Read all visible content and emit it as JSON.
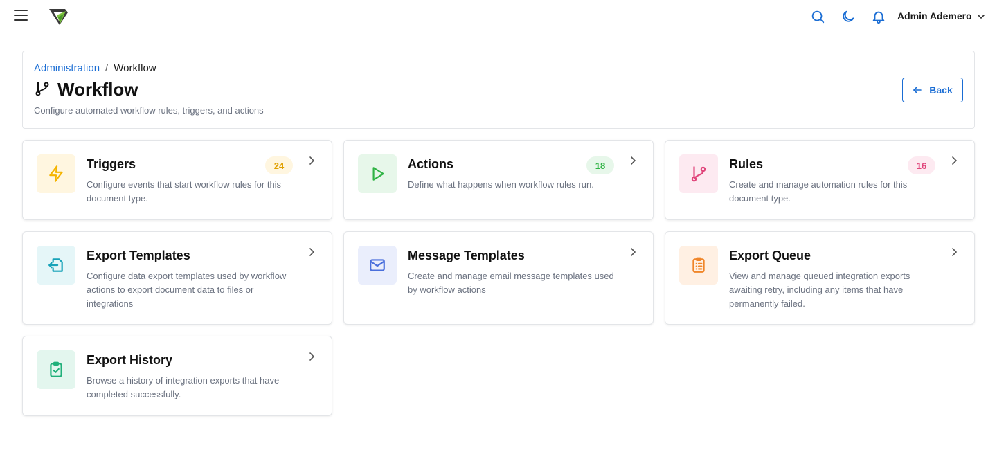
{
  "topbar": {
    "user_name": "Admin Ademero",
    "accent": "#1a6dd4"
  },
  "header": {
    "breadcrumb": {
      "parent": "Administration",
      "separator": "/",
      "current": "Workflow"
    },
    "title": "Workflow",
    "subtitle": "Configure automated workflow rules, triggers, and actions",
    "back_label": "Back"
  },
  "cards": [
    {
      "title": "Triggers",
      "description": "Configure events that start workflow rules for this document type.",
      "badge": "24",
      "icon": "lightning-icon",
      "icon_color": "#f5b400",
      "icon_bg": "#fff6e0",
      "badge_color": "#e0a000",
      "badge_bg": "#fff6e0"
    },
    {
      "title": "Actions",
      "description": "Define what happens when workflow rules run.",
      "badge": "18",
      "icon": "play-icon",
      "icon_color": "#2fb344",
      "icon_bg": "#e7f7ea",
      "badge_color": "#2fb344",
      "badge_bg": "#e7f7ea"
    },
    {
      "title": "Rules",
      "description": "Create and manage automation rules for this document type.",
      "badge": "16",
      "icon": "git-branch-icon",
      "icon_color": "#e0457b",
      "icon_bg": "#fdeaf1",
      "badge_color": "#e0457b",
      "badge_bg": "#fdeaf1"
    },
    {
      "title": "Export Templates",
      "description": "Configure data export templates used by workflow actions to export document data to files or integrations",
      "icon": "file-export-icon",
      "icon_color": "#17a2b8",
      "icon_bg": "#e5f6f8"
    },
    {
      "title": "Message Templates",
      "description": "Create and manage email message templates used by workflow actions",
      "icon": "envelope-icon",
      "icon_color": "#4a6fdc",
      "icon_bg": "#eaeefc"
    },
    {
      "title": "Export Queue",
      "description": "View and manage queued integration exports awaiting retry, including any items that have permanently failed.",
      "icon": "clipboard-list-icon",
      "icon_color": "#f0862a",
      "icon_bg": "#fff0e3"
    },
    {
      "title": "Export History",
      "description": "Browse a history of integration exports that have completed successfully.",
      "icon": "clipboard-check-icon",
      "icon_color": "#20b07a",
      "icon_bg": "#e3f6ee"
    }
  ]
}
